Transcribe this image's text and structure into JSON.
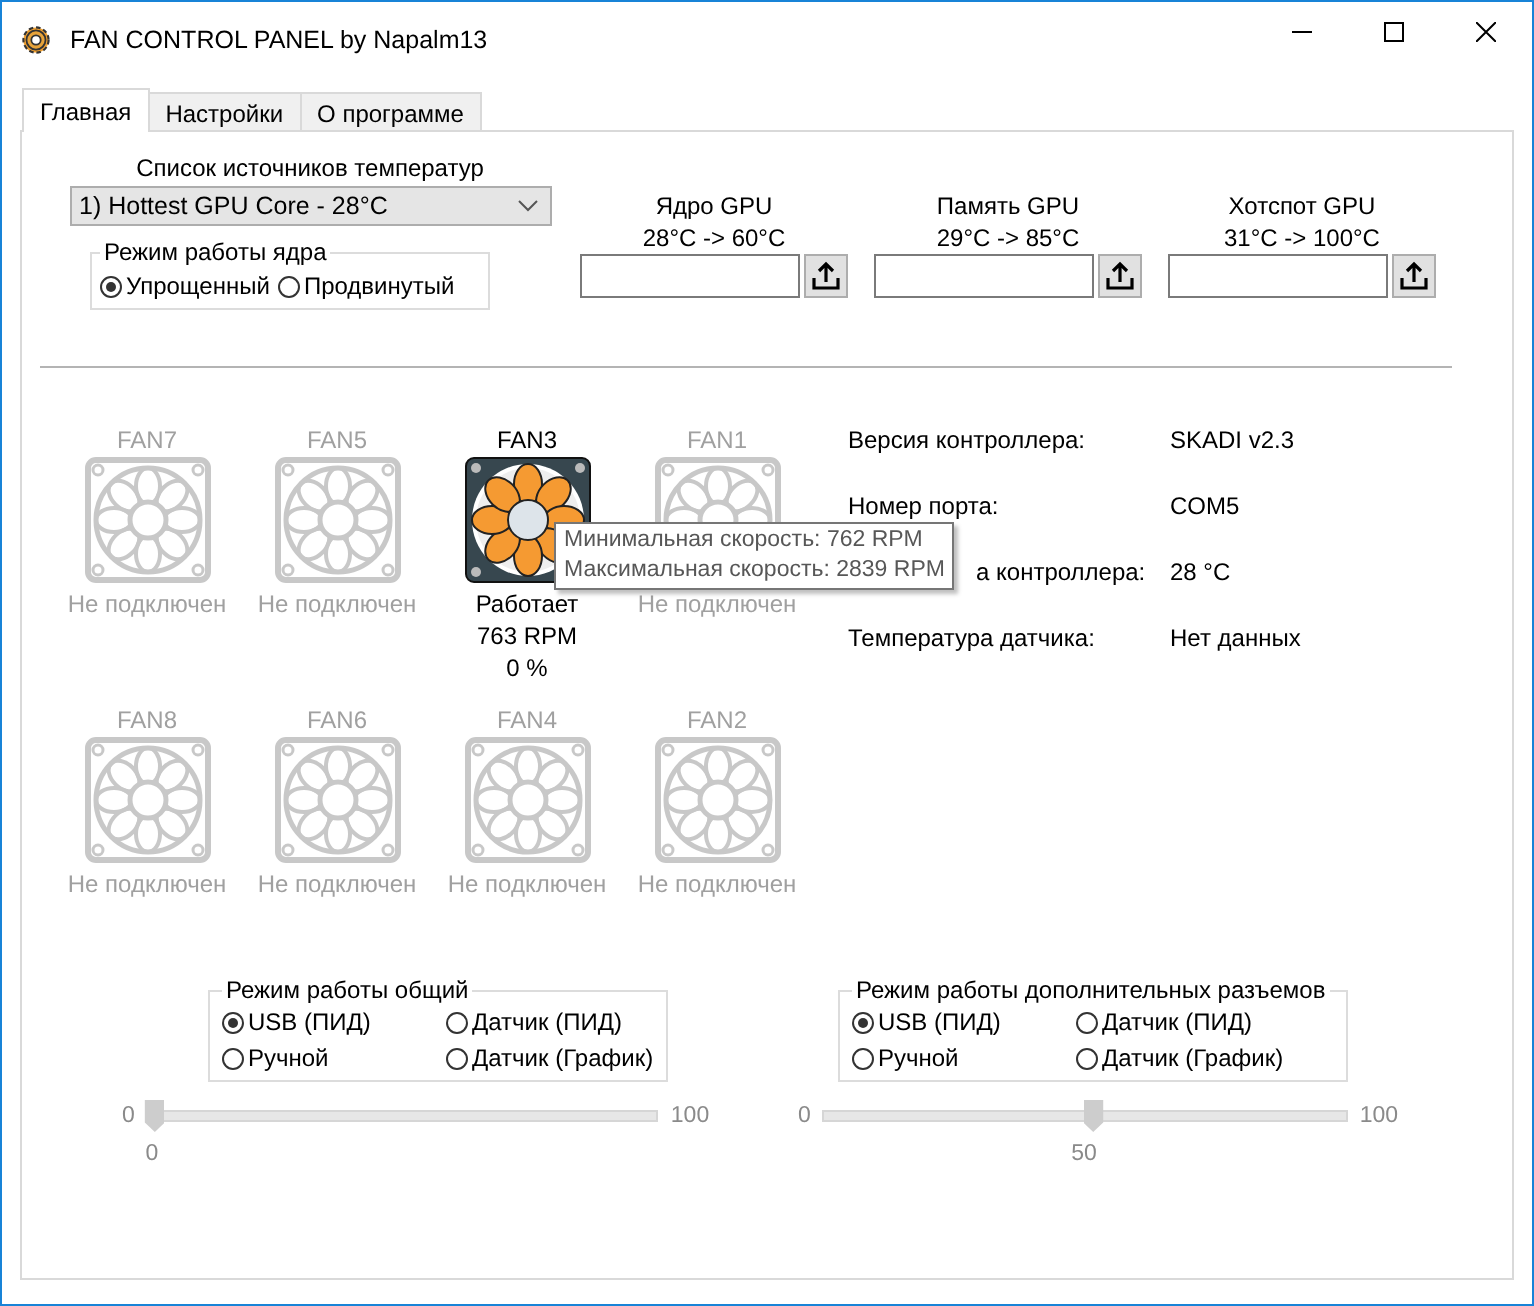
{
  "window": {
    "title": "FAN CONTROL PANEL by Napalm13"
  },
  "tabs": [
    {
      "label": "Главная",
      "selected": true
    },
    {
      "label": "Настройки",
      "selected": false
    },
    {
      "label": "О программе",
      "selected": false
    }
  ],
  "source": {
    "label": "Список источников температур",
    "value": "1) Hottest GPU Core - 28°C"
  },
  "core_mode": {
    "title": "Режим работы ядра",
    "options": [
      {
        "label": "Упрощенный",
        "selected": true
      },
      {
        "label": "Продвинутый",
        "selected": false
      }
    ]
  },
  "sensors": [
    {
      "name": "Ядро GPU",
      "range": "28°C -> 60°C"
    },
    {
      "name": "Память GPU",
      "range": "29°C -> 85°C"
    },
    {
      "name": "Хотспот GPU",
      "range": "31°C -> 100°C"
    }
  ],
  "fans": [
    {
      "name": "FAN7",
      "connected": false,
      "status": "Не подключен"
    },
    {
      "name": "FAN5",
      "connected": false,
      "status": "Не подключен"
    },
    {
      "name": "FAN3",
      "connected": true,
      "status": "Работает",
      "rpm": "763 RPM",
      "percent": "0 %"
    },
    {
      "name": "FAN1",
      "connected": false,
      "status": "Не подключен"
    },
    {
      "name": "FAN8",
      "connected": false,
      "status": "Не подключен"
    },
    {
      "name": "FAN6",
      "connected": false,
      "status": "Не подключен"
    },
    {
      "name": "FAN4",
      "connected": false,
      "status": "Не подключен"
    },
    {
      "name": "FAN2",
      "connected": false,
      "status": "Не подключен"
    }
  ],
  "tooltip": {
    "lines": [
      "Минимальная скорость: 762 RPM",
      "Максимальная скорость: 2839 RPM"
    ]
  },
  "info": [
    {
      "label": "Версия контроллера:",
      "value": "SKADI v2.3"
    },
    {
      "label": "Номер порта:",
      "value": "COM5"
    },
    {
      "label": "а контроллера:",
      "value": "28 °C",
      "covered": true
    },
    {
      "label": "Температура датчика:",
      "value": "Нет данных"
    }
  ],
  "modes": [
    {
      "title": "Режим работы общий",
      "options": [
        {
          "label": "USB (ПИД)",
          "selected": true
        },
        {
          "label": "Датчик (ПИД)",
          "selected": false
        },
        {
          "label": "Ручной",
          "selected": false
        },
        {
          "label": "Датчик (График)",
          "selected": false
        }
      ],
      "slider": {
        "min": "0",
        "max": "100",
        "value": "0",
        "level": 0
      }
    },
    {
      "title": "Режим работы дополнительных разъемов",
      "options": [
        {
          "label": "USB (ПИД)",
          "selected": true
        },
        {
          "label": "Датчик (ПИД)",
          "selected": false
        },
        {
          "label": "Ручной",
          "selected": false
        },
        {
          "label": "Датчик (График)",
          "selected": false
        }
      ],
      "slider": {
        "min": "0",
        "max": "100",
        "value": "50",
        "level": 0.5
      }
    }
  ]
}
